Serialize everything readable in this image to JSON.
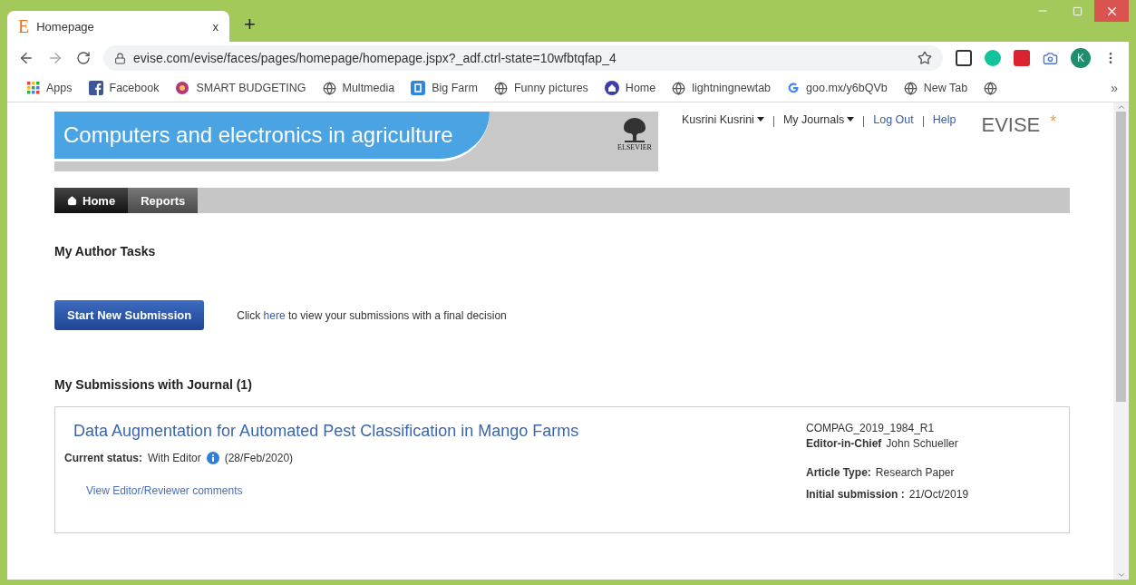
{
  "browser": {
    "tab": {
      "icon_letter": "E",
      "title": "Homepage",
      "close": "x"
    },
    "new_tab": "+",
    "url": "evise.com/evise/faces/pages/homepage/homepage.jspx?_adf.ctrl-state=10wfbtqfap_4",
    "profile_letter": "K"
  },
  "bookmarks": [
    {
      "kind": "apps",
      "label": "Apps"
    },
    {
      "kind": "facebook",
      "label": "Facebook"
    },
    {
      "kind": "flower",
      "label": "SMART BUDGETING"
    },
    {
      "kind": "globe",
      "label": "Multmedia"
    },
    {
      "kind": "number",
      "label": "Big Farm"
    },
    {
      "kind": "globe",
      "label": "Funny pictures"
    },
    {
      "kind": "home",
      "label": "Home"
    },
    {
      "kind": "globe",
      "label": "lightningnewtab"
    },
    {
      "kind": "google",
      "label": "goo.mx/y6bQVb"
    },
    {
      "kind": "globe",
      "label": "New Tab"
    },
    {
      "kind": "globe"
    }
  ],
  "bookmarks_overflow": "»",
  "header": {
    "journal_title": "Computers and electronics in agriculture",
    "publisher": "ELSEVIER",
    "user": "Kusrini Kusrini",
    "my_journals": "My Journals",
    "log_out": "Log Out",
    "help": "Help",
    "brand": "EVISE",
    "brand_mark": "*"
  },
  "nav_tabs": [
    {
      "label": "Home",
      "selected": true
    },
    {
      "label": "Reports",
      "selected": false
    }
  ],
  "author_tasks": {
    "heading": "My Author Tasks",
    "button": "Start New Submission",
    "note_before": "Click",
    "note_link": "here",
    "note_after": "to view your submissions with a final decision"
  },
  "submissions": {
    "heading": "My Submissions with Journal (1)",
    "items": [
      {
        "title": "Data Augmentation for Automated Pest Classification in Mango Farms",
        "status_label": "Current status:",
        "status": "With Editor",
        "status_date": "(28/Feb/2020)",
        "comments_link": "View Editor/Reviewer comments",
        "manuscript_id": "COMPAG_2019_1984_R1",
        "editor_label": "Editor-in-Chief",
        "editor": "John Schueller",
        "type_label": "Article Type:",
        "type": "Research Paper",
        "initial_label": "Initial submission :",
        "initial": "21/Oct/2019"
      }
    ]
  }
}
